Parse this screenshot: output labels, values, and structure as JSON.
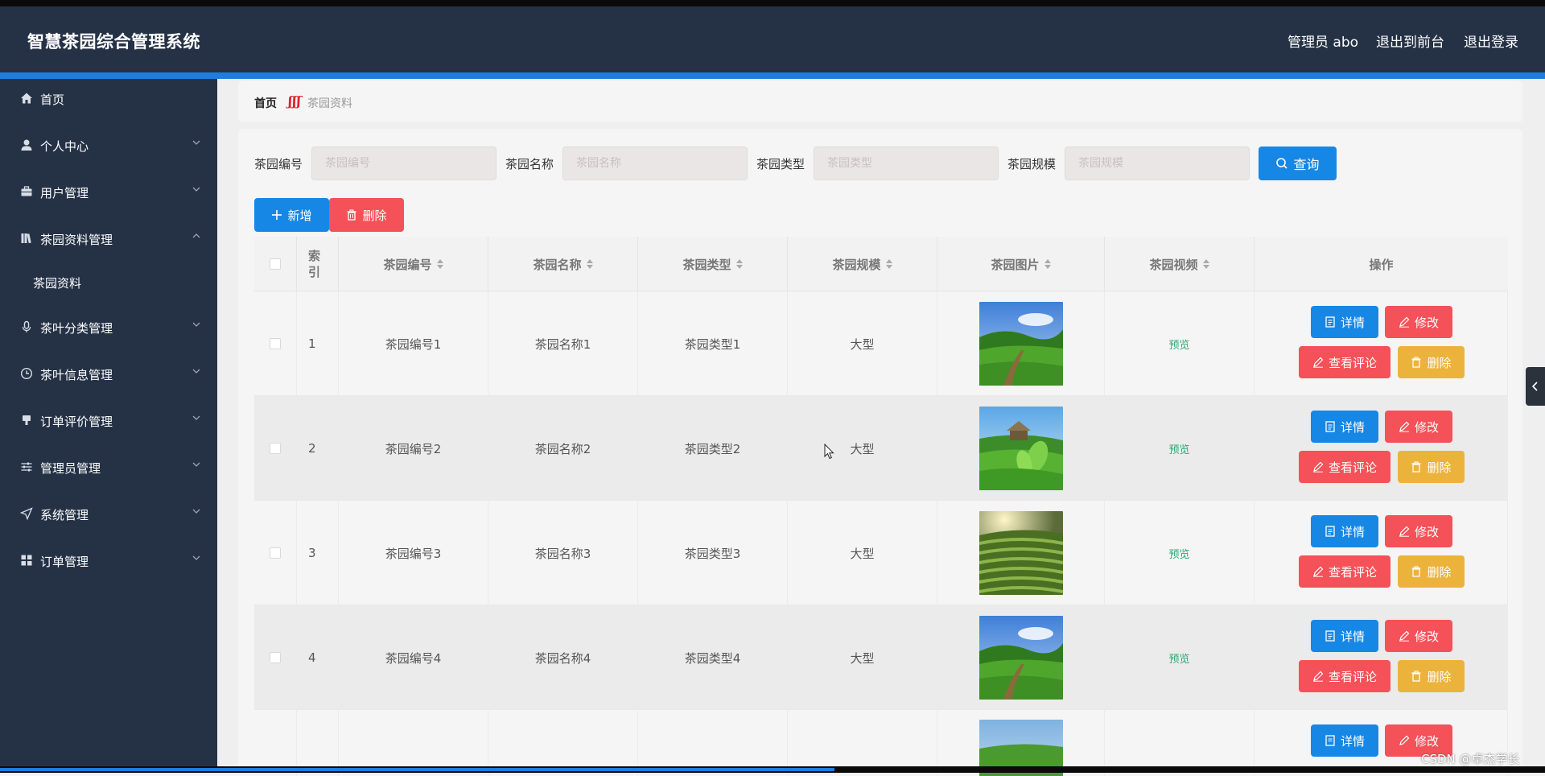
{
  "header": {
    "title": "智慧茶园综合管理系统",
    "admin": "管理员 abo",
    "to_front": "退出到前台",
    "logout": "退出登录"
  },
  "sidebar": {
    "items": [
      {
        "label": "首页",
        "icon": "home-icon",
        "arrow": false
      },
      {
        "label": "个人中心",
        "icon": "person-icon",
        "arrow": true
      },
      {
        "label": "用户管理",
        "icon": "briefcase-icon",
        "arrow": true
      },
      {
        "label": "茶园资料管理",
        "icon": "library-icon",
        "arrow": true,
        "expanded": true
      },
      {
        "label": "茶叶分类管理",
        "icon": "microphone-icon",
        "arrow": true
      },
      {
        "label": "茶叶信息管理",
        "icon": "clock-icon",
        "arrow": true
      },
      {
        "label": "订单评价管理",
        "icon": "stamp-icon",
        "arrow": true
      },
      {
        "label": "管理员管理",
        "icon": "sliders-icon",
        "arrow": true
      },
      {
        "label": "系统管理",
        "icon": "send-icon",
        "arrow": true
      },
      {
        "label": "订单管理",
        "icon": "grid-icon",
        "arrow": true
      }
    ],
    "submenu": "茶园资料"
  },
  "breadcrumb": {
    "home": "首页",
    "separator": "ʃʃʃ",
    "current": "茶园资料"
  },
  "search": {
    "fields": [
      {
        "label": "茶园编号",
        "placeholder": "茶园编号"
      },
      {
        "label": "茶园名称",
        "placeholder": "茶园名称"
      },
      {
        "label": "茶园类型",
        "placeholder": "茶园类型"
      },
      {
        "label": "茶园规模",
        "placeholder": "茶园规模"
      }
    ],
    "query_label": "查询"
  },
  "toolbar": {
    "add_label": "新增",
    "delete_label": "删除"
  },
  "table": {
    "headers": {
      "index": "索引",
      "code": "茶园编号",
      "name": "茶园名称",
      "type": "茶园类型",
      "scale": "茶园规模",
      "image": "茶园图片",
      "video": "茶园视频",
      "ops": "操作"
    },
    "rows": [
      {
        "index": "1",
        "code": "茶园编号1",
        "name": "茶园名称1",
        "type": "茶园类型1",
        "scale": "大型",
        "video": "预览",
        "image": "tea-field-path"
      },
      {
        "index": "2",
        "code": "茶园编号2",
        "name": "茶园名称2",
        "type": "茶园类型2",
        "scale": "大型",
        "video": "预览",
        "image": "tea-leaves-closeup"
      },
      {
        "index": "3",
        "code": "茶园编号3",
        "name": "茶园名称3",
        "type": "茶园类型3",
        "scale": "大型",
        "video": "预览",
        "image": "tea-terraces"
      },
      {
        "index": "4",
        "code": "茶园编号4",
        "name": "茶园名称4",
        "type": "茶园类型4",
        "scale": "大型",
        "video": "预览",
        "image": "tea-field-path"
      }
    ],
    "actions": {
      "detail": "详情",
      "edit": "修改",
      "comments": "查看评论",
      "delete": "删除"
    }
  },
  "colors": {
    "header_bg": "#253246",
    "accent": "#1787e6",
    "danger": "#f45158",
    "warning": "#ecb33c",
    "success_text": "#2aa873"
  },
  "watermark": "CSDN @卓杰学长",
  "video_progress": 0.54
}
